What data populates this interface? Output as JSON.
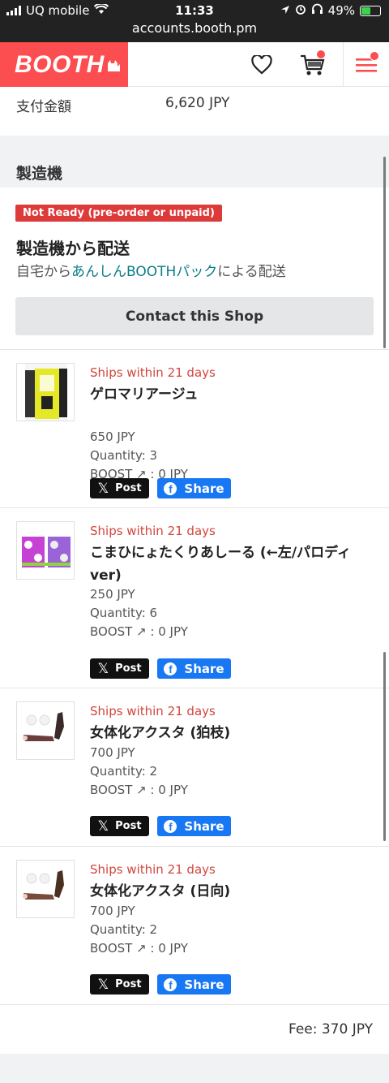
{
  "status_bar": {
    "carrier": "UQ mobile",
    "time": "11:33",
    "battery": "49%",
    "url": "accounts.booth.pm"
  },
  "header": {
    "logo": "BOOTH",
    "icons": [
      "heart-icon",
      "cart-icon",
      "menu-icon"
    ]
  },
  "payment": {
    "label": "支付金額",
    "value": "6,620 JPY"
  },
  "section": {
    "title": "製造機"
  },
  "shipping": {
    "badge": "Not Ready (pre-order or unpaid)",
    "title": "製造機から配送",
    "sub_prefix": "自宅から",
    "sub_link": "あんしんBOOTHパック",
    "sub_suffix": "による配送",
    "contact_button": "Contact this Shop"
  },
  "share": {
    "x_label": "Post",
    "fb_label": "Share"
  },
  "items": [
    {
      "ship": "Ships within 21 days",
      "name": "ゲロマリアージュ",
      "price": "650 JPY",
      "quantity": "Quantity:  3",
      "boost": "BOOST ↗︎ : 0 JPY"
    },
    {
      "ship": "Ships within 21 days",
      "name": "こまひにょたくりあしーる (←左/パロディver)",
      "price": "250 JPY",
      "quantity": "Quantity:  6",
      "boost": "BOOST ↗︎ : 0 JPY"
    },
    {
      "ship": "Ships within 21 days",
      "name": "女体化アクスタ (狛枝)",
      "price": "700 JPY",
      "quantity": "Quantity:  2",
      "boost": "BOOST ↗︎ : 0 JPY"
    },
    {
      "ship": "Ships within 21 days",
      "name": "女体化アクスタ (日向)",
      "price": "700 JPY",
      "quantity": "Quantity:  2",
      "boost": "BOOST ↗︎ : 0 JPY"
    }
  ],
  "fee": "Fee:  370 JPY",
  "colors": {
    "brand": "#fc4d50",
    "ship_text": "#d2463c",
    "badge": "#dd3a3a",
    "link": "#0b7d87",
    "facebook": "#1877f2"
  }
}
